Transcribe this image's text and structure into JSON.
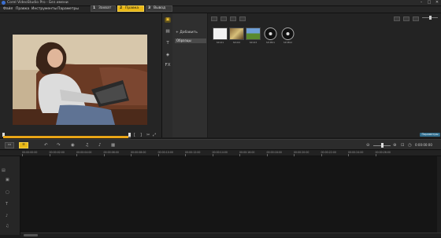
{
  "window": {
    "title": "Corel VideoStudio Pro - Без имени"
  },
  "menu": [
    {
      "label": "Файл"
    },
    {
      "label": "Правка"
    },
    {
      "label": "Инструменты"
    },
    {
      "label": "Параметры"
    }
  ],
  "steps": [
    {
      "num": "1",
      "label": "Захват",
      "active": false
    },
    {
      "num": "2",
      "label": "Правка",
      "active": true
    },
    {
      "num": "3",
      "label": "Вывод",
      "active": false
    }
  ],
  "preview": {
    "project_label": "Проект",
    "clip_label": "Клип",
    "progress_fraction": 0.98,
    "timecode": "00:00:00:00"
  },
  "library": {
    "add_label": "Добавить",
    "folder": "Образцы",
    "browse_label": "Обзор",
    "options_label": "Параметры",
    "thumbs": [
      {
        "label": "SP-I01"
      },
      {
        "label": "SP-I02"
      },
      {
        "label": "SP-I03"
      },
      {
        "label": "SP-M01"
      },
      {
        "label": "SP-M02"
      }
    ]
  },
  "timeline": {
    "time": "0:00:00:00",
    "ruler": [
      "00:00:00:00",
      "00:00:02:00",
      "00:00:04:00",
      "00:00:06:00",
      "00:00:08:00",
      "00:00:10:00",
      "00:00:12:00",
      "00:00:14:00",
      "00:00:16:00",
      "00:00:18:00",
      "00:00:20:00",
      "00:00:22:00",
      "00:00:24:00",
      "00:00:26:00"
    ]
  }
}
